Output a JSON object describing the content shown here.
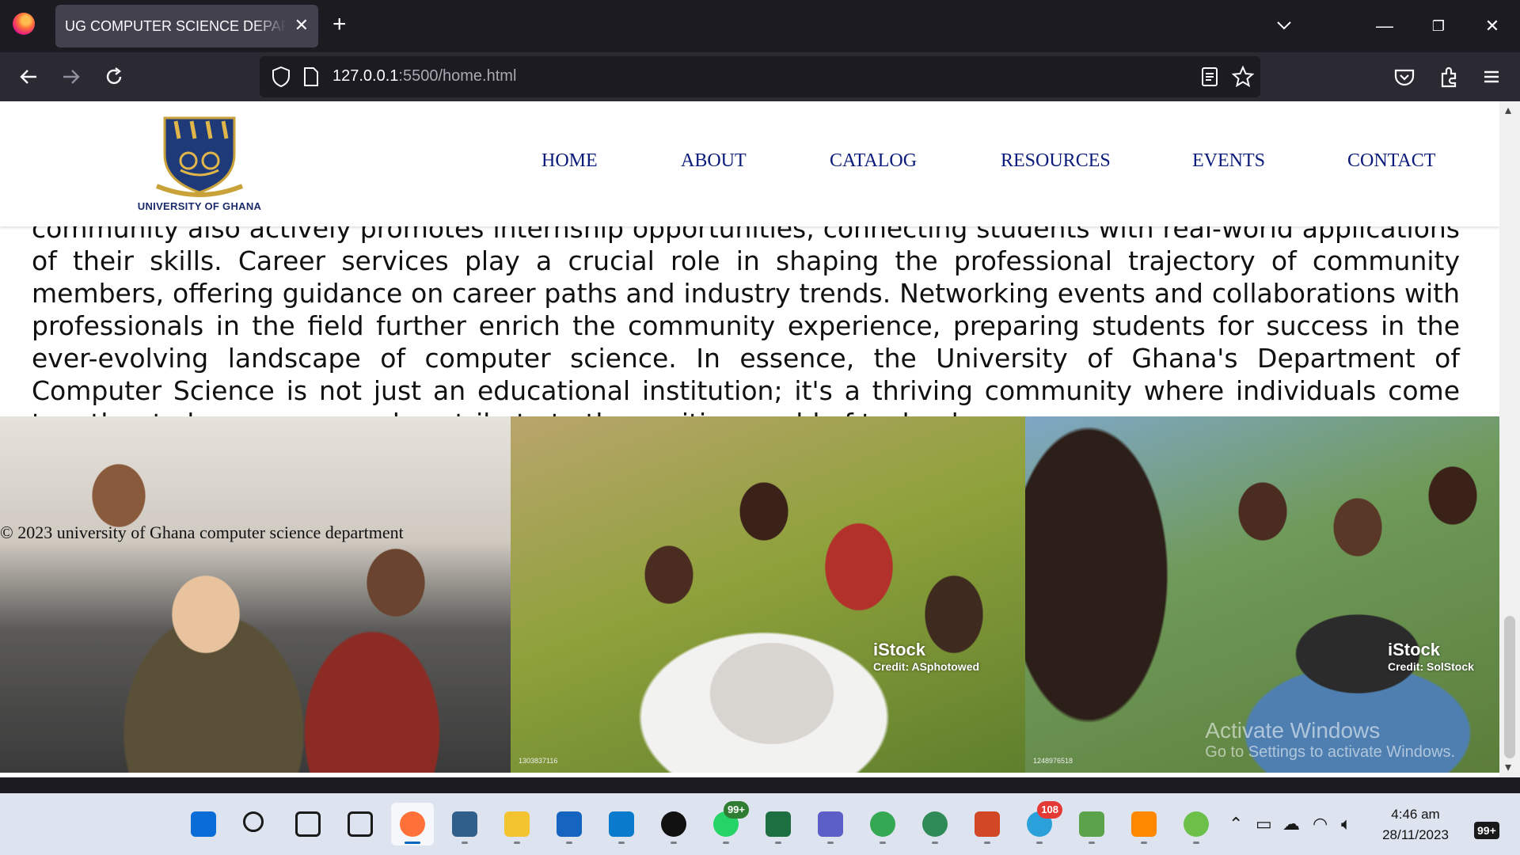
{
  "browser": {
    "tab_title": "UG COMPUTER SCIENCE DEPARTMENT",
    "tab_close": "✕",
    "new_tab": "+",
    "url_host": "127.0.0.1",
    "url_path": ":5500/home.html",
    "window_controls": {
      "minimize": "—",
      "restore": "❐",
      "close": "✕"
    }
  },
  "site": {
    "logo_caption": "UNIVERSITY OF GHANA",
    "nav": [
      "HOME",
      "ABOUT",
      "CATALOG",
      "RESOURCES",
      "EVENTS",
      "CONTACT"
    ],
    "article_text": "community also actively promotes internship opportunities, connecting students with real-world applications of their skills. Career services play a crucial role in shaping the professional trajectory of community members, offering guidance on career paths and industry trends. Networking events and collaborations with professionals in the field further enrich the community experience, preparing students for success in the ever-evolving landscape of computer science. In essence, the University of Ghana's Department of Computer Science is not just an educational institution; it's a thriving community where individuals come together to learn, grow, and contribute to the exciting world of technology.",
    "footer": "© 2023 university of Ghana computer science department",
    "photos": [
      {
        "watermark": "",
        "credit": "",
        "stock_id": ""
      },
      {
        "watermark": "iStock",
        "credit": "Credit: ASphotowed",
        "stock_id": "1303837116"
      },
      {
        "watermark": "iStock",
        "credit": "Credit: SolStock",
        "stock_id": "1248976518"
      }
    ]
  },
  "overlay": {
    "activate_title": "Activate Windows",
    "activate_sub": "Go to Settings to activate Windows."
  },
  "taskbar": {
    "apps": [
      {
        "name": "start",
        "color": "#0a6cd6"
      },
      {
        "name": "search",
        "color": "#1a1a1a"
      },
      {
        "name": "task-view",
        "color": "#1a1a1a"
      },
      {
        "name": "widgets",
        "color": "#1a1a1a"
      },
      {
        "name": "firefox",
        "color": "#ff7139",
        "active": true
      },
      {
        "name": "photos",
        "color": "#2f5f8a"
      },
      {
        "name": "file-explorer",
        "color": "#f4c430"
      },
      {
        "name": "store",
        "color": "#1565c0"
      },
      {
        "name": "vscode",
        "color": "#0a7acc"
      },
      {
        "name": "tiktok",
        "color": "#111111"
      },
      {
        "name": "whatsapp",
        "color": "#25d366",
        "badge": "99+"
      },
      {
        "name": "excel",
        "color": "#1d6f42"
      },
      {
        "name": "teams",
        "color": "#5b5fc7"
      },
      {
        "name": "chrome",
        "color": "#34a853"
      },
      {
        "name": "edge-globe",
        "color": "#2e8b57"
      },
      {
        "name": "powerpoint",
        "color": "#d24726"
      },
      {
        "name": "telegram",
        "color": "#2aa1da",
        "badge": "108"
      },
      {
        "name": "notepad",
        "color": "#5aa34a"
      },
      {
        "name": "vlc",
        "color": "#ff8800"
      },
      {
        "name": "android-app",
        "color": "#6cc04a"
      }
    ],
    "time": "4:46 am",
    "date": "28/11/2023",
    "notifications": "99+"
  }
}
